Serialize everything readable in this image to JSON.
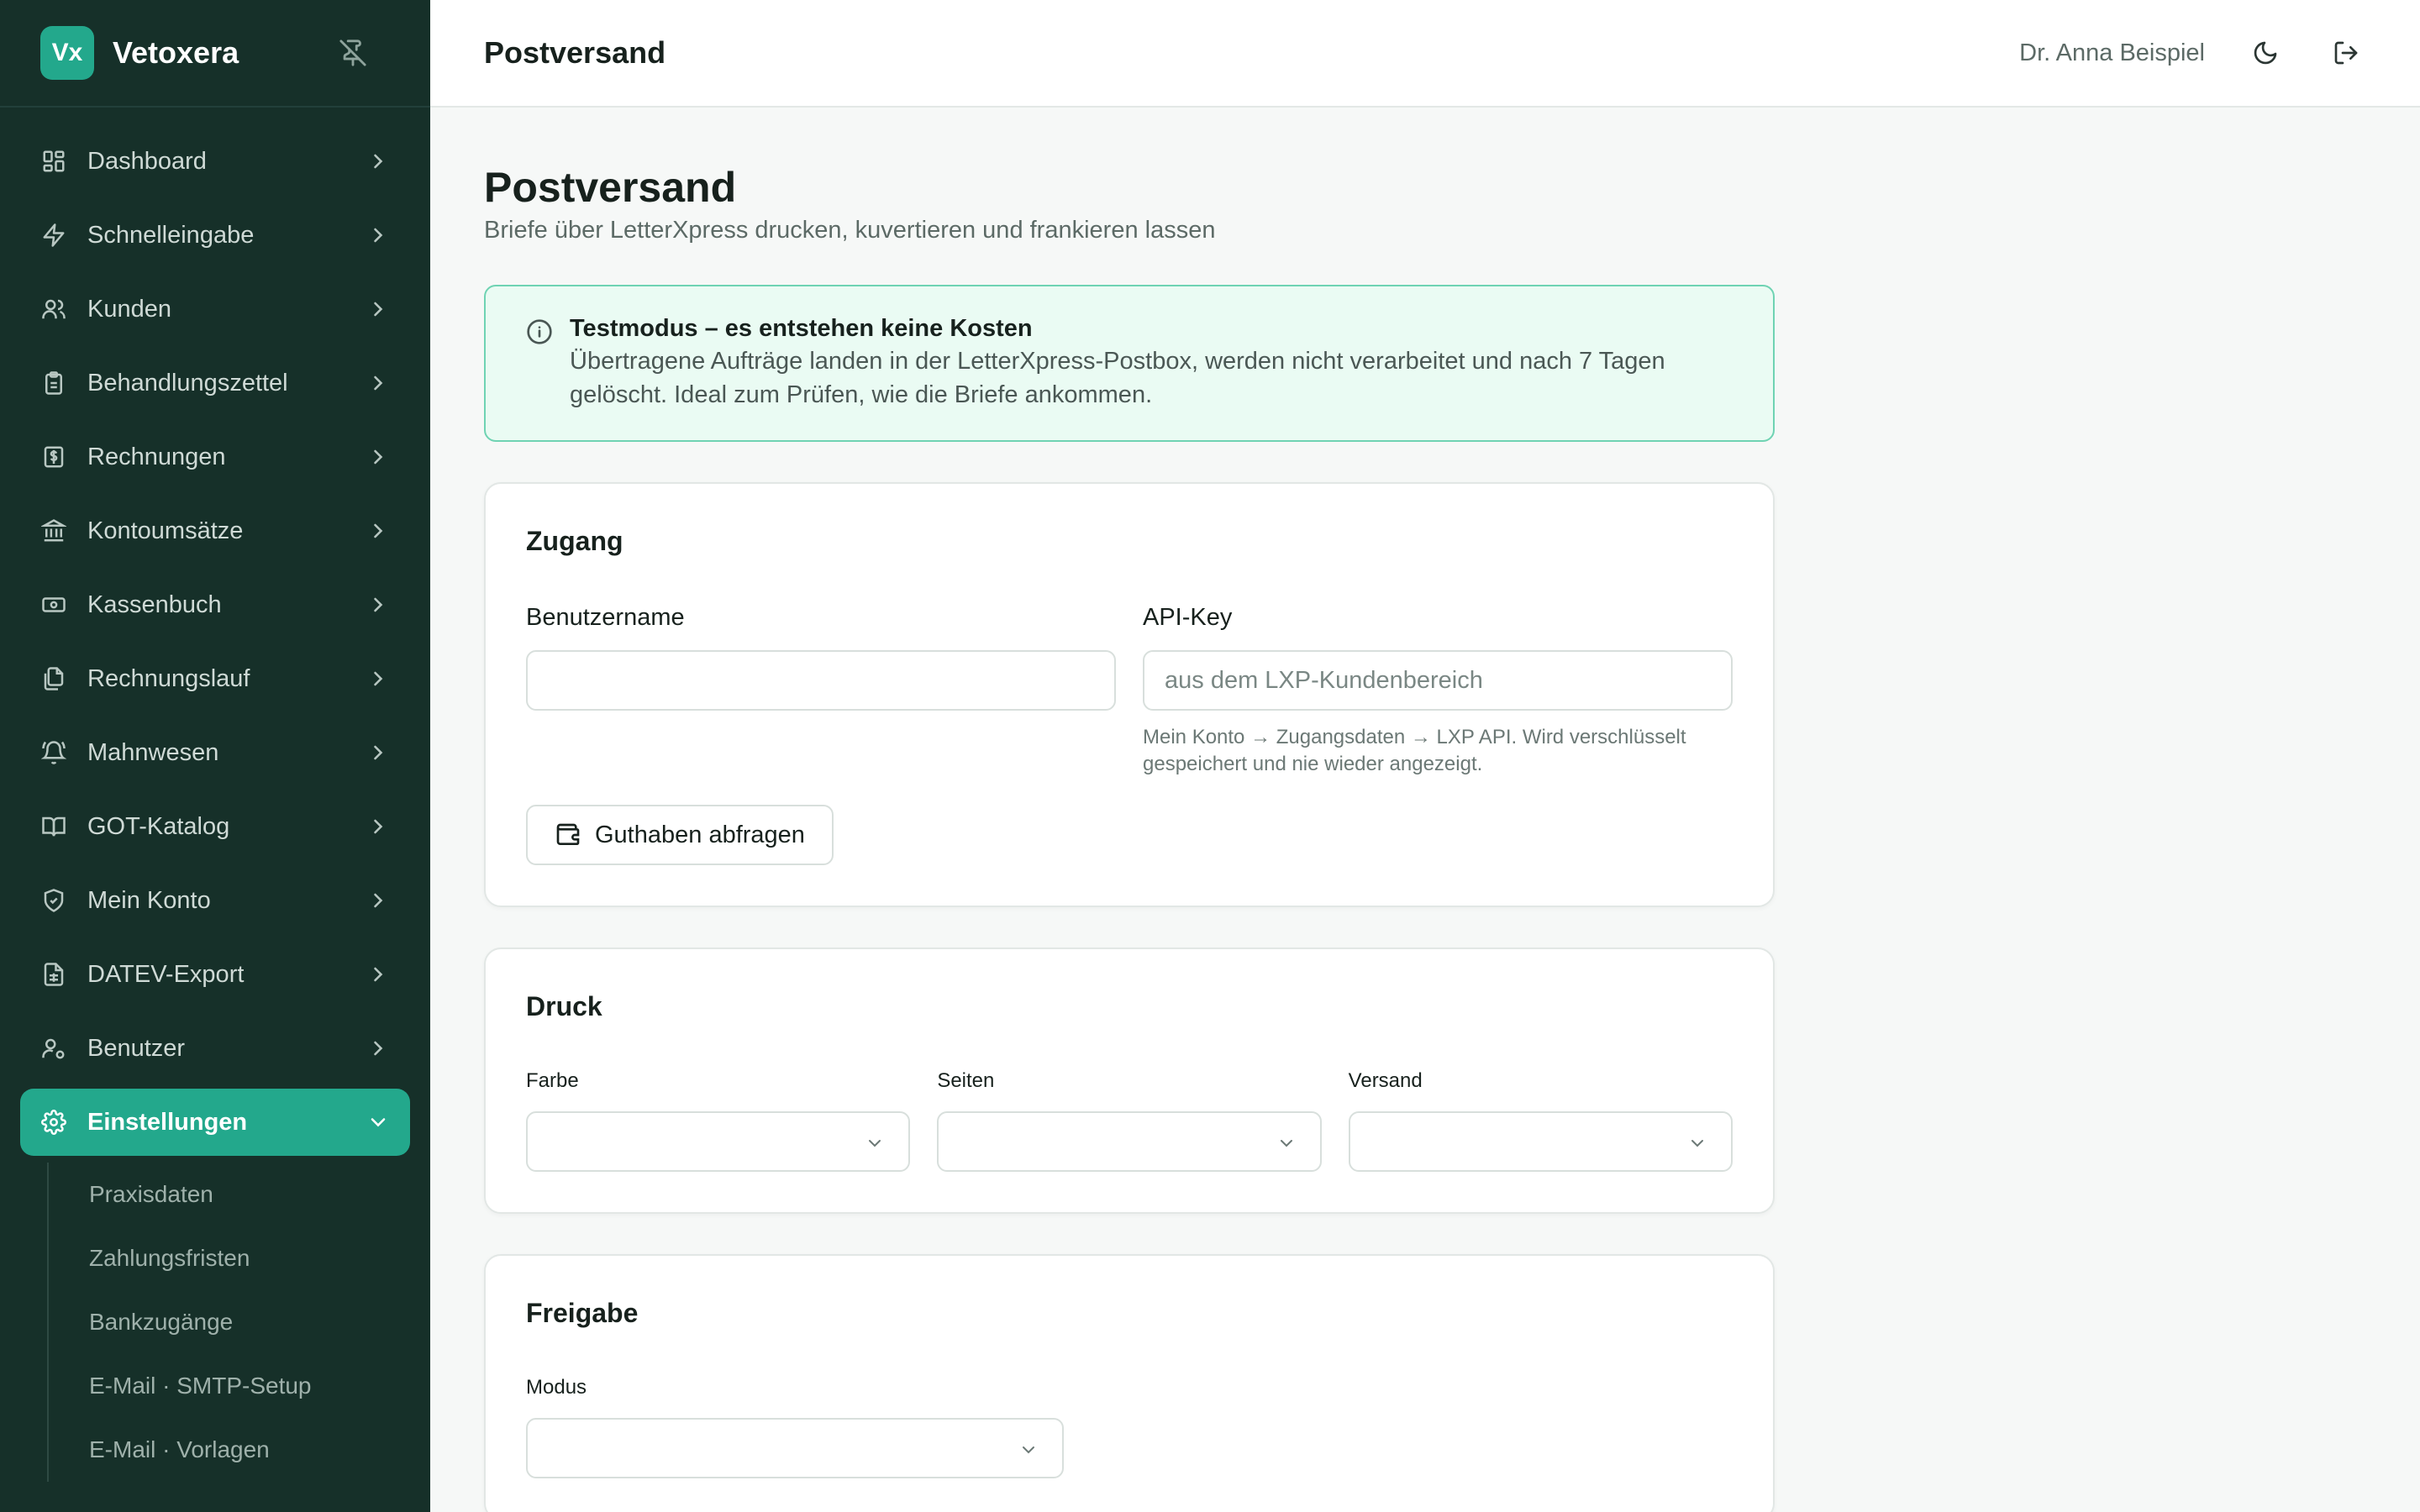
{
  "app": {
    "logo": "Vx",
    "name": "Vetoxera",
    "pin_icon": "pin-off-icon"
  },
  "sidebar": {
    "items": [
      {
        "label": "Dashboard",
        "icon": "dashboard-icon"
      },
      {
        "label": "Schnelleingabe",
        "icon": "zap-icon"
      },
      {
        "label": "Kunden",
        "icon": "users-icon"
      },
      {
        "label": "Behandlungszettel",
        "icon": "clipboard-icon"
      },
      {
        "label": "Rechnungen",
        "icon": "invoice-icon"
      },
      {
        "label": "Kontoumsätze",
        "icon": "bank-icon"
      },
      {
        "label": "Kassenbuch",
        "icon": "cash-icon"
      },
      {
        "label": "Rechnungslauf",
        "icon": "files-icon"
      },
      {
        "label": "Mahnwesen",
        "icon": "bell-icon"
      },
      {
        "label": "GOT-Katalog",
        "icon": "book-icon"
      },
      {
        "label": "Mein Konto",
        "icon": "shield-icon"
      },
      {
        "label": "DATEV-Export",
        "icon": "spreadsheet-icon"
      },
      {
        "label": "Benutzer",
        "icon": "user-cog-icon"
      },
      {
        "label": "Einstellungen",
        "icon": "gear-icon"
      }
    ],
    "subitems": [
      "Praxisdaten",
      "Zahlungsfristen",
      "Bankzugänge",
      "E-Mail · SMTP-Setup",
      "E-Mail · Vorlagen"
    ]
  },
  "topbar": {
    "title": "Postversand",
    "user": "Dr. Anna Beispiel"
  },
  "page": {
    "title": "Postversand",
    "subtitle": "Briefe über LetterXpress drucken, kuvertieren und frankieren lassen"
  },
  "alert": {
    "title": "Testmodus – es entstehen keine Kosten",
    "text": "Übertragene Aufträge landen in der LetterXpress-Postbox, werden nicht verarbeitet und nach 7 Tagen gelöscht. Ideal zum Prüfen, wie die Briefe ankommen."
  },
  "access": {
    "heading": "Zugang",
    "username_label": "Benutzername",
    "username_value": "",
    "apikey_label": "API-Key",
    "apikey_placeholder": "aus dem LXP-Kundenbereich",
    "apikey_hint": "Mein Konto → Zugangsdaten → LXP API. Wird verschlüsselt gespeichert und nie wieder angezeigt.",
    "balance_button": "Guthaben abfragen"
  },
  "print": {
    "heading": "Druck",
    "color_label": "Farbe",
    "pages_label": "Seiten",
    "shipping_label": "Versand"
  },
  "release": {
    "heading": "Freigabe",
    "mode_label": "Modus"
  },
  "colors": {
    "sidebar": "#163029",
    "accent": "#23a88c",
    "alert_bg": "#eafbf3",
    "alert_border": "#6fd3b3"
  }
}
